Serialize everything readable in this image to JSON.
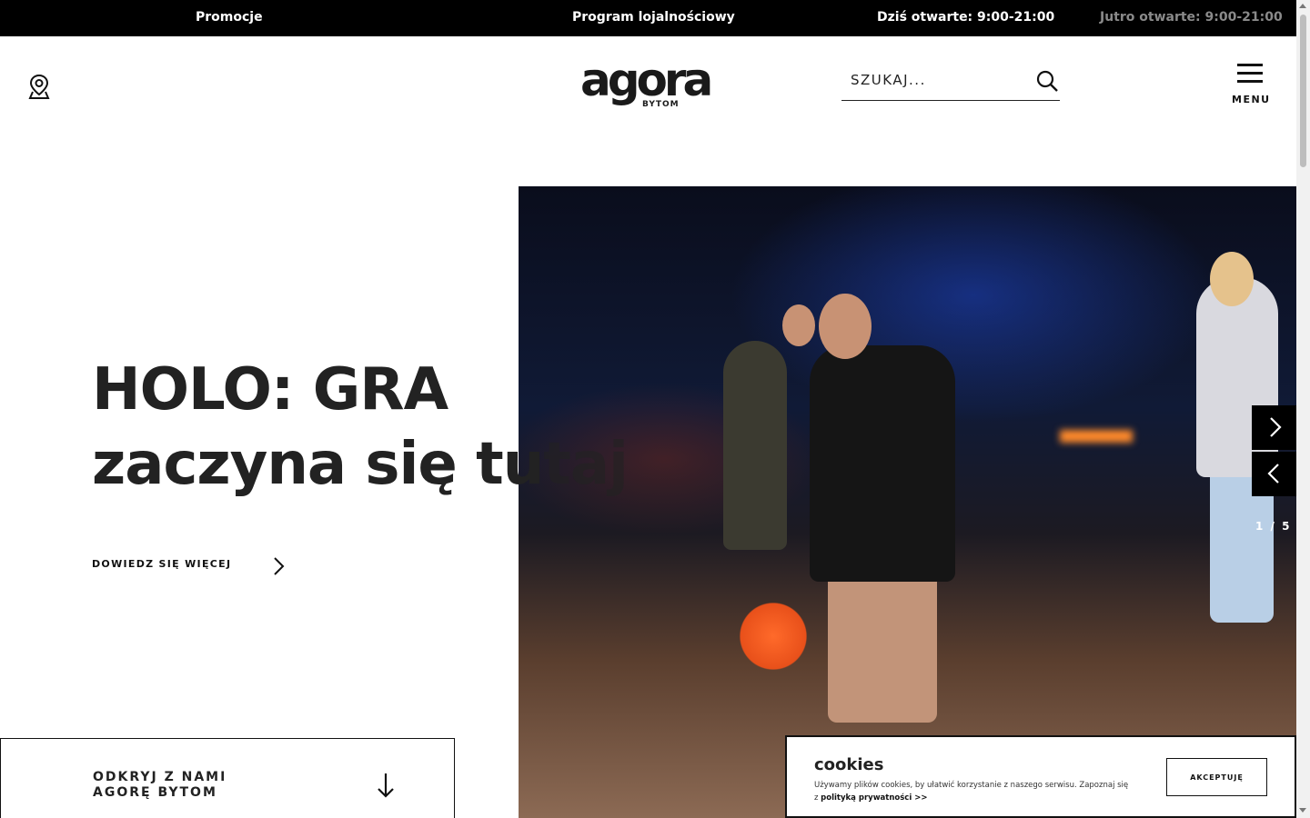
{
  "topbar": {
    "promotions": "Promocje",
    "loyalty": "Program lojalnościowy",
    "today_hours": "Dziś otwarte: 9:00-21:00",
    "tomorrow_hours": "Jutro otwarte: 9:00-21:00"
  },
  "header": {
    "logo_main": "agora",
    "logo_sub": "BYTOM",
    "search_placeholder": "SZUKAJ...",
    "menu_label": "MENU"
  },
  "hero": {
    "title_line1": "HOLO: GRA",
    "title_line2_a": "zaczyna się tu",
    "title_line2_b": "taj",
    "learn_more": "DOWIEDZ SIĘ WIĘCEJ",
    "slide_counter": "1 / 5"
  },
  "discover": {
    "label_line1": "ODKRYJ Z NAMI",
    "label_line2": "AGORĘ BYTOM"
  },
  "cookies": {
    "title": "cookies",
    "text": "Używamy plików cookies, by ułatwić korzystanie z naszego serwisu. Zapoznaj się z ",
    "link": "polityką prywatności >>",
    "accept": "AKCEPTUJĘ"
  },
  "colors": {
    "topbar_bg": "#000000",
    "text_dark": "#222222",
    "muted": "#8a8a8a"
  }
}
